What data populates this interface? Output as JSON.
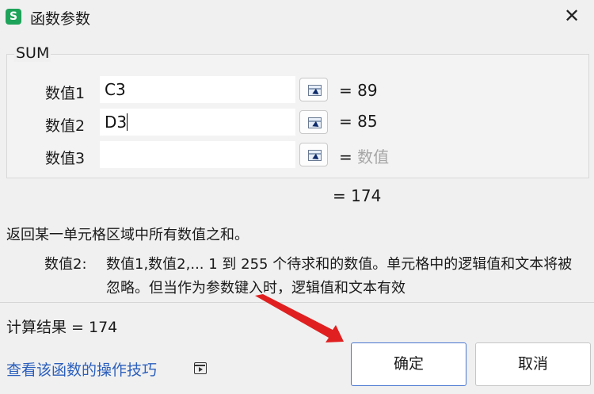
{
  "window": {
    "app_icon_letter": "S",
    "title": "函数参数",
    "close_glyph": "✕"
  },
  "function": {
    "name": "SUM",
    "args": [
      {
        "label": "数值1",
        "value": "C3",
        "result": "= 89",
        "placeholder": false
      },
      {
        "label": "数值2",
        "value": "D3",
        "result": "= 85",
        "placeholder": false
      },
      {
        "label": "数值3",
        "value": "",
        "result_eq": "=",
        "result_text": "数值",
        "placeholder": true
      }
    ],
    "total": "= 174",
    "description": "返回某一单元格区域中所有数值之和。",
    "param_label": "数值2:",
    "param_help": "数值1,数值2,... 1 到 255 个待求和的数值。单元格中的逻辑值和文本将被忽略。但当作为参数键入时，逻辑值和文本有效"
  },
  "footer": {
    "calc_result": "计算结果 = 174",
    "help_link": "查看该函数的操作技巧",
    "ok_label": "确定",
    "cancel_label": "取消"
  },
  "colors": {
    "accent": "#4a78d1",
    "link": "#2b5fbd",
    "app_icon": "#1ea35a",
    "annotation_arrow": "#e02020"
  },
  "icons": [
    "app-icon",
    "close-icon",
    "range-picker-icon",
    "video-icon"
  ]
}
